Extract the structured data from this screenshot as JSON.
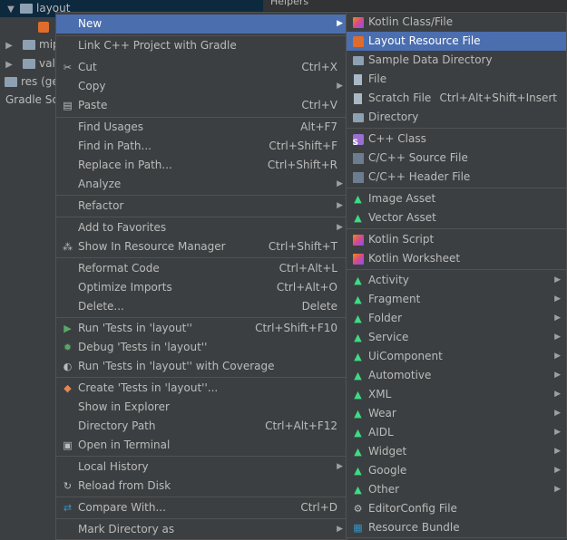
{
  "tree": {
    "row0": "layout",
    "row2": "mip",
    "row3": "valu",
    "row4": "res (ge",
    "row5": "Gradle Scr"
  },
  "helpers_label": "Helpers",
  "context_menu": {
    "new": "New",
    "link": "Link C++ Project with Gradle",
    "cut": "Cut",
    "cut_sc": "Ctrl+X",
    "copy": "Copy",
    "paste": "Paste",
    "paste_sc": "Ctrl+V",
    "find_usages": "Find Usages",
    "find_usages_sc": "Alt+F7",
    "find_in_path": "Find in Path...",
    "find_in_path_sc": "Ctrl+Shift+F",
    "replace_in_path": "Replace in Path...",
    "replace_in_path_sc": "Ctrl+Shift+R",
    "analyze": "Analyze",
    "refactor": "Refactor",
    "add_favorites": "Add to Favorites",
    "show_resource_manager": "Show In Resource Manager",
    "show_resource_manager_sc": "Ctrl+Shift+T",
    "reformat": "Reformat Code",
    "reformat_sc": "Ctrl+Alt+L",
    "optimize": "Optimize Imports",
    "optimize_sc": "Ctrl+Alt+O",
    "delete": "Delete...",
    "delete_sc": "Delete",
    "run_tests": "Run 'Tests in 'layout''",
    "run_tests_sc": "Ctrl+Shift+F10",
    "debug_tests": "Debug 'Tests in 'layout''",
    "run_coverage": "Run 'Tests in 'layout'' with Coverage",
    "create_tests": "Create 'Tests in 'layout''...",
    "show_explorer": "Show in Explorer",
    "directory_path": "Directory Path",
    "directory_path_sc": "Ctrl+Alt+F12",
    "open_terminal": "Open in Terminal",
    "local_history": "Local History",
    "reload": "Reload from Disk",
    "compare": "Compare With...",
    "compare_sc": "Ctrl+D",
    "mark_directory": "Mark Directory as"
  },
  "submenu": {
    "kotlin_class": "Kotlin Class/File",
    "layout_resource": "Layout Resource File",
    "sample_data": "Sample Data Directory",
    "file": "File",
    "scratch": "Scratch File",
    "scratch_sc": "Ctrl+Alt+Shift+Insert",
    "directory": "Directory",
    "cpp_class": "C++ Class",
    "cpp_source": "C/C++ Source File",
    "cpp_header": "C/C++ Header File",
    "image_asset": "Image Asset",
    "vector_asset": "Vector Asset",
    "kotlin_script": "Kotlin Script",
    "kotlin_worksheet": "Kotlin Worksheet",
    "activity": "Activity",
    "fragment": "Fragment",
    "folder": "Folder",
    "service": "Service",
    "uicomponent": "UiComponent",
    "automotive": "Automotive",
    "xml": "XML",
    "wear": "Wear",
    "aidl": "AIDL",
    "widget": "Widget",
    "google": "Google",
    "other": "Other",
    "editorconfig": "EditorConfig File",
    "resource_bundle": "Resource Bundle"
  },
  "colors": {
    "highlight": "#4b6eaf",
    "menu_bg": "#3c3f41",
    "android_green": "#3ddc84"
  }
}
